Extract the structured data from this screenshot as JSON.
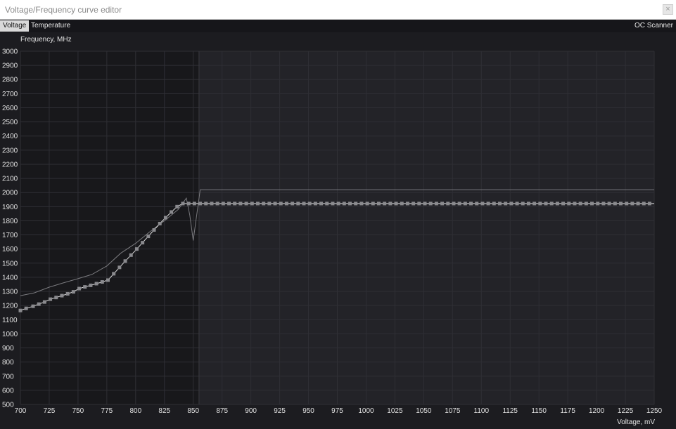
{
  "window": {
    "title": "Voltage/Frequency curve editor",
    "close_label": "×"
  },
  "tabs": [
    {
      "label": "Voltage",
      "active": true
    },
    {
      "label": "Temperature",
      "active": false
    }
  ],
  "oc_scanner_label": "OC Scanner",
  "colors": {
    "plot_bg": "#232328",
    "plot_bg_dark": "#18181b",
    "grid": "#2f2f35",
    "curve": "#e0e0e0",
    "reference_curve": "#7a7a7e",
    "point": "#8a8a8e"
  },
  "chart_data": {
    "type": "line",
    "ylabel": "Frequency, MHz",
    "xlabel": "Voltage, mV",
    "xlim": [
      700,
      1250
    ],
    "ylim": [
      500,
      3000
    ],
    "x_ticks": [
      700,
      725,
      750,
      775,
      800,
      825,
      850,
      875,
      900,
      925,
      950,
      975,
      1000,
      1025,
      1050,
      1075,
      1100,
      1125,
      1150,
      1175,
      1200,
      1225,
      1250
    ],
    "y_ticks": [
      500,
      600,
      700,
      800,
      900,
      1000,
      1100,
      1200,
      1300,
      1400,
      1500,
      1600,
      1700,
      1800,
      1900,
      2000,
      2100,
      2200,
      2300,
      2400,
      2500,
      2600,
      2700,
      2800,
      2900,
      3000
    ],
    "highlight_range_max_x": 855,
    "grid": true,
    "series": [
      {
        "role": "reference",
        "points": [
          [
            700,
            1270
          ],
          [
            712,
            1290
          ],
          [
            725,
            1330
          ],
          [
            737,
            1360
          ],
          [
            750,
            1390
          ],
          [
            762,
            1420
          ],
          [
            775,
            1480
          ],
          [
            787,
            1570
          ],
          [
            800,
            1640
          ],
          [
            812,
            1720
          ],
          [
            825,
            1800
          ],
          [
            837,
            1880
          ],
          [
            844,
            1960
          ],
          [
            847,
            1840
          ],
          [
            850,
            1660
          ],
          [
            853,
            1840
          ],
          [
            856,
            2020
          ],
          [
            1250,
            2020
          ]
        ]
      },
      {
        "role": "curve",
        "points": [
          [
            700,
            1165
          ],
          [
            705,
            1180
          ],
          [
            711,
            1195
          ],
          [
            716,
            1210
          ],
          [
            721,
            1225
          ],
          [
            726,
            1245
          ],
          [
            731,
            1257
          ],
          [
            736,
            1270
          ],
          [
            741,
            1283
          ],
          [
            746,
            1297
          ],
          [
            751,
            1320
          ],
          [
            756,
            1332
          ],
          [
            761,
            1343
          ],
          [
            766,
            1355
          ],
          [
            771,
            1367
          ],
          [
            776,
            1380
          ],
          [
            781,
            1425
          ],
          [
            786,
            1470
          ],
          [
            791,
            1515
          ],
          [
            796,
            1557
          ],
          [
            801,
            1600
          ],
          [
            806,
            1645
          ],
          [
            811,
            1690
          ],
          [
            816,
            1735
          ],
          [
            821,
            1780
          ],
          [
            826,
            1822
          ],
          [
            831,
            1862
          ],
          [
            836,
            1900
          ],
          [
            841,
            1922
          ],
          [
            846,
            1922
          ],
          [
            851,
            1922
          ],
          [
            1250,
            1922
          ]
        ]
      }
    ],
    "markers_x": [
      700,
      705,
      711,
      716,
      721,
      726,
      731,
      736,
      741,
      746,
      751,
      756,
      761,
      766,
      771,
      776,
      781,
      786,
      791,
      796,
      801,
      806,
      811,
      816,
      821,
      826,
      831,
      836,
      841,
      846,
      851,
      856,
      861,
      866,
      871,
      876,
      881,
      886,
      891,
      896,
      901,
      906,
      911,
      916,
      921,
      926,
      931,
      936,
      941,
      946,
      951,
      956,
      961,
      966,
      971,
      976,
      981,
      986,
      991,
      996,
      1001,
      1006,
      1011,
      1016,
      1021,
      1026,
      1031,
      1036,
      1041,
      1046,
      1051,
      1056,
      1061,
      1066,
      1071,
      1076,
      1081,
      1086,
      1091,
      1096,
      1101,
      1106,
      1111,
      1116,
      1121,
      1126,
      1131,
      1136,
      1141,
      1146,
      1151,
      1156,
      1161,
      1166,
      1171,
      1176,
      1181,
      1186,
      1191,
      1196,
      1201,
      1206,
      1211,
      1216,
      1221,
      1226,
      1231,
      1236,
      1241,
      1246
    ]
  }
}
